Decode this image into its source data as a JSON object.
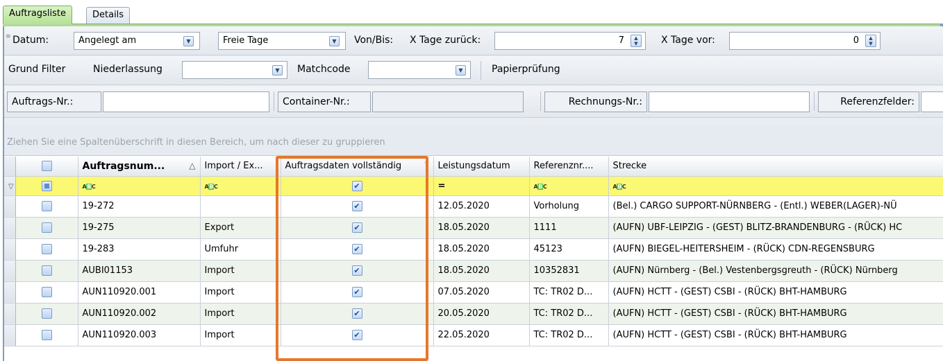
{
  "tabs": [
    {
      "label": "Auftragsliste",
      "active": true
    },
    {
      "label": "Details",
      "active": false
    }
  ],
  "filter_row1": {
    "datum_label": "Datum:",
    "datum_value": "Angelegt am",
    "freie_tage_value": "Freie Tage",
    "vonbis_label": "Von/Bis:",
    "xtage_zurueck_label": "X Tage zurück:",
    "xtage_zurueck_value": "7",
    "xtage_vor_label": "X Tage vor:",
    "xtage_vor_value": "0"
  },
  "filter_row2": {
    "grund_filter_label": "Grund Filter",
    "niederlassung_label": "Niederlassung",
    "niederlassung_value": "",
    "matchcode_label": "Matchcode",
    "matchcode_value": "",
    "papierpruefung_label": "Papierprüfung"
  },
  "filter_row3": {
    "auftrags_nr_label": "Auftrags-Nr.:",
    "container_nr_label": "Container-Nr.:",
    "rechnungs_nr_label": "Rechnungs-Nr.:",
    "referenzfelder_label": "Referenzfelder:"
  },
  "grid": {
    "group_hint": "Ziehen Sie eine Spaltenüberschrift in diesen Bereich, um nach dieser zu gruppieren",
    "columns": [
      "Auftragsnum...",
      "Import / Ex...",
      "Auftragsdaten vollständig",
      "Leistungsdatum",
      "Referenznr....",
      "Strecke"
    ],
    "filter_eq": "=",
    "rows": [
      {
        "nr": "19-272",
        "type": "",
        "date": "12.05.2020",
        "ref": "Vorholung",
        "strecke": "(Bel.) CARGO SUPPORT-NÜRNBERG - (Entl.) WEBER(LAGER)-NÜ"
      },
      {
        "nr": "19-275",
        "type": "Export",
        "date": "18.05.2020",
        "ref": "1111",
        "strecke": "(AUFN) UBF-LEIPZIG - (GEST) BLITZ-BRANDENBURG - (RÜCK) HC"
      },
      {
        "nr": "19-283",
        "type": "Umfuhr",
        "date": "18.05.2020",
        "ref": "45123",
        "strecke": "(AUFN) BIEGEL-HEITERSHEIM - (RÜCK) CDN-REGENSBURG"
      },
      {
        "nr": "AUBI01153",
        "type": "Import",
        "date": "18.05.2020",
        "ref": "10352831",
        "strecke": "(AUFN) Nürnberg - (Bel.) Vestenbergsgreuth - (RÜCK) Nürnberg"
      },
      {
        "nr": "AUN110920.001",
        "type": "Import",
        "date": "07.05.2020",
        "ref": "TC: TR02 D...",
        "strecke": "(AUFN) HCTT - (GEST) CSBI - (RÜCK) BHT-HAMBURG"
      },
      {
        "nr": "AUN110920.002",
        "type": "Import",
        "date": "20.05.2020",
        "ref": "TC: TR02 D...",
        "strecke": "(AUFN) HCTT - (GEST) CSBI - (RÜCK) BHT-HAMBURG"
      },
      {
        "nr": "AUN110920.003",
        "type": "Import",
        "date": "22.05.2020",
        "ref": "TC: TR02 D...",
        "strecke": "(AUFN) HCTT - (GEST) CSBI - (RÜCK) BHT-HAMBURG"
      }
    ]
  }
}
